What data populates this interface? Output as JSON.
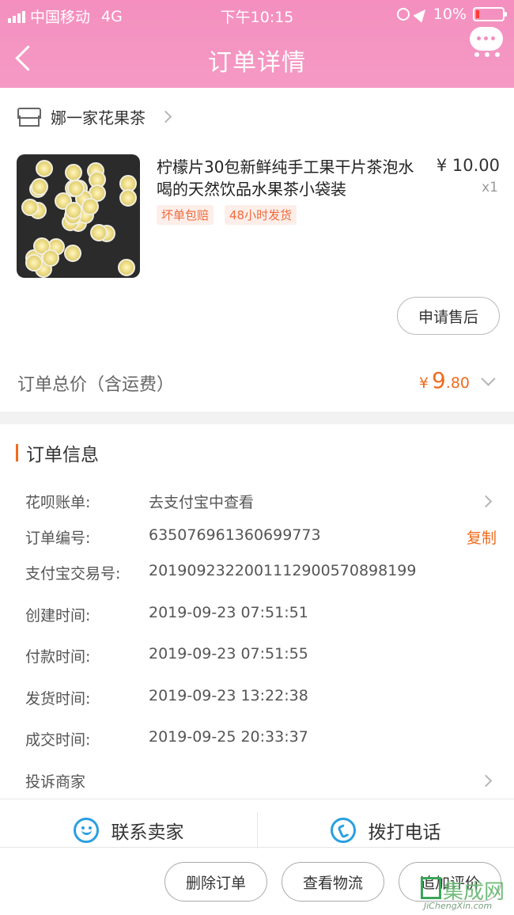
{
  "status_bar": {
    "carrier": "中国移动",
    "network": "4G",
    "time": "下午10:15",
    "battery": "10%",
    "colors": {
      "battery_low": "#ff3b30"
    }
  },
  "nav": {
    "title": "订单详情",
    "back_icon": "chevron-left-icon",
    "message_icon": "chat-bubble-icon"
  },
  "shop": {
    "name": "娜一家花果茶",
    "icon": "store-icon"
  },
  "product": {
    "title": "柠檬片30包新鲜纯手工果干片茶泡水喝的天然饮品水果茶小袋装",
    "price": "¥ 10.00",
    "quantity": "x1",
    "tags": [
      "坏单包赔",
      "48小时发货"
    ]
  },
  "actions": {
    "after_sale": "申请售后"
  },
  "total": {
    "label": "订单总价（含运费）",
    "currency": "¥",
    "integer": "9",
    "decimal": ".80"
  },
  "order_info": {
    "heading": "订单信息",
    "huabei_label": "花呗账单:",
    "huabei_value": "去支付宝中查看",
    "order_no_label": "订单编号:",
    "order_no_value": "635076961360699773",
    "copy_label": "复制",
    "alipay_label": "支付宝交易号:",
    "alipay_value": "2019092322001112900570898199",
    "created_label": "创建时间:",
    "created_value": "2019-09-23 07:51:51",
    "paid_label": "付款时间:",
    "paid_value": "2019-09-23 07:51:55",
    "shipped_label": "发货时间:",
    "shipped_value": "2019-09-23 13:22:38",
    "completed_label": "成交时间:",
    "completed_value": "2019-09-25 20:33:37",
    "complaint_label": "投诉商家"
  },
  "contact": {
    "seller": "联系卖家",
    "phone": "拨打电话"
  },
  "bottom": {
    "delete": "删除订单",
    "logistics": "查看物流",
    "review": "追加评价"
  },
  "watermark": {
    "main": "集成网",
    "sub": "JiChengXin.com"
  },
  "colors": {
    "accent": "#f06b1e",
    "header_pink": "#f48fbf",
    "icon_blue": "#2a9fe0"
  }
}
